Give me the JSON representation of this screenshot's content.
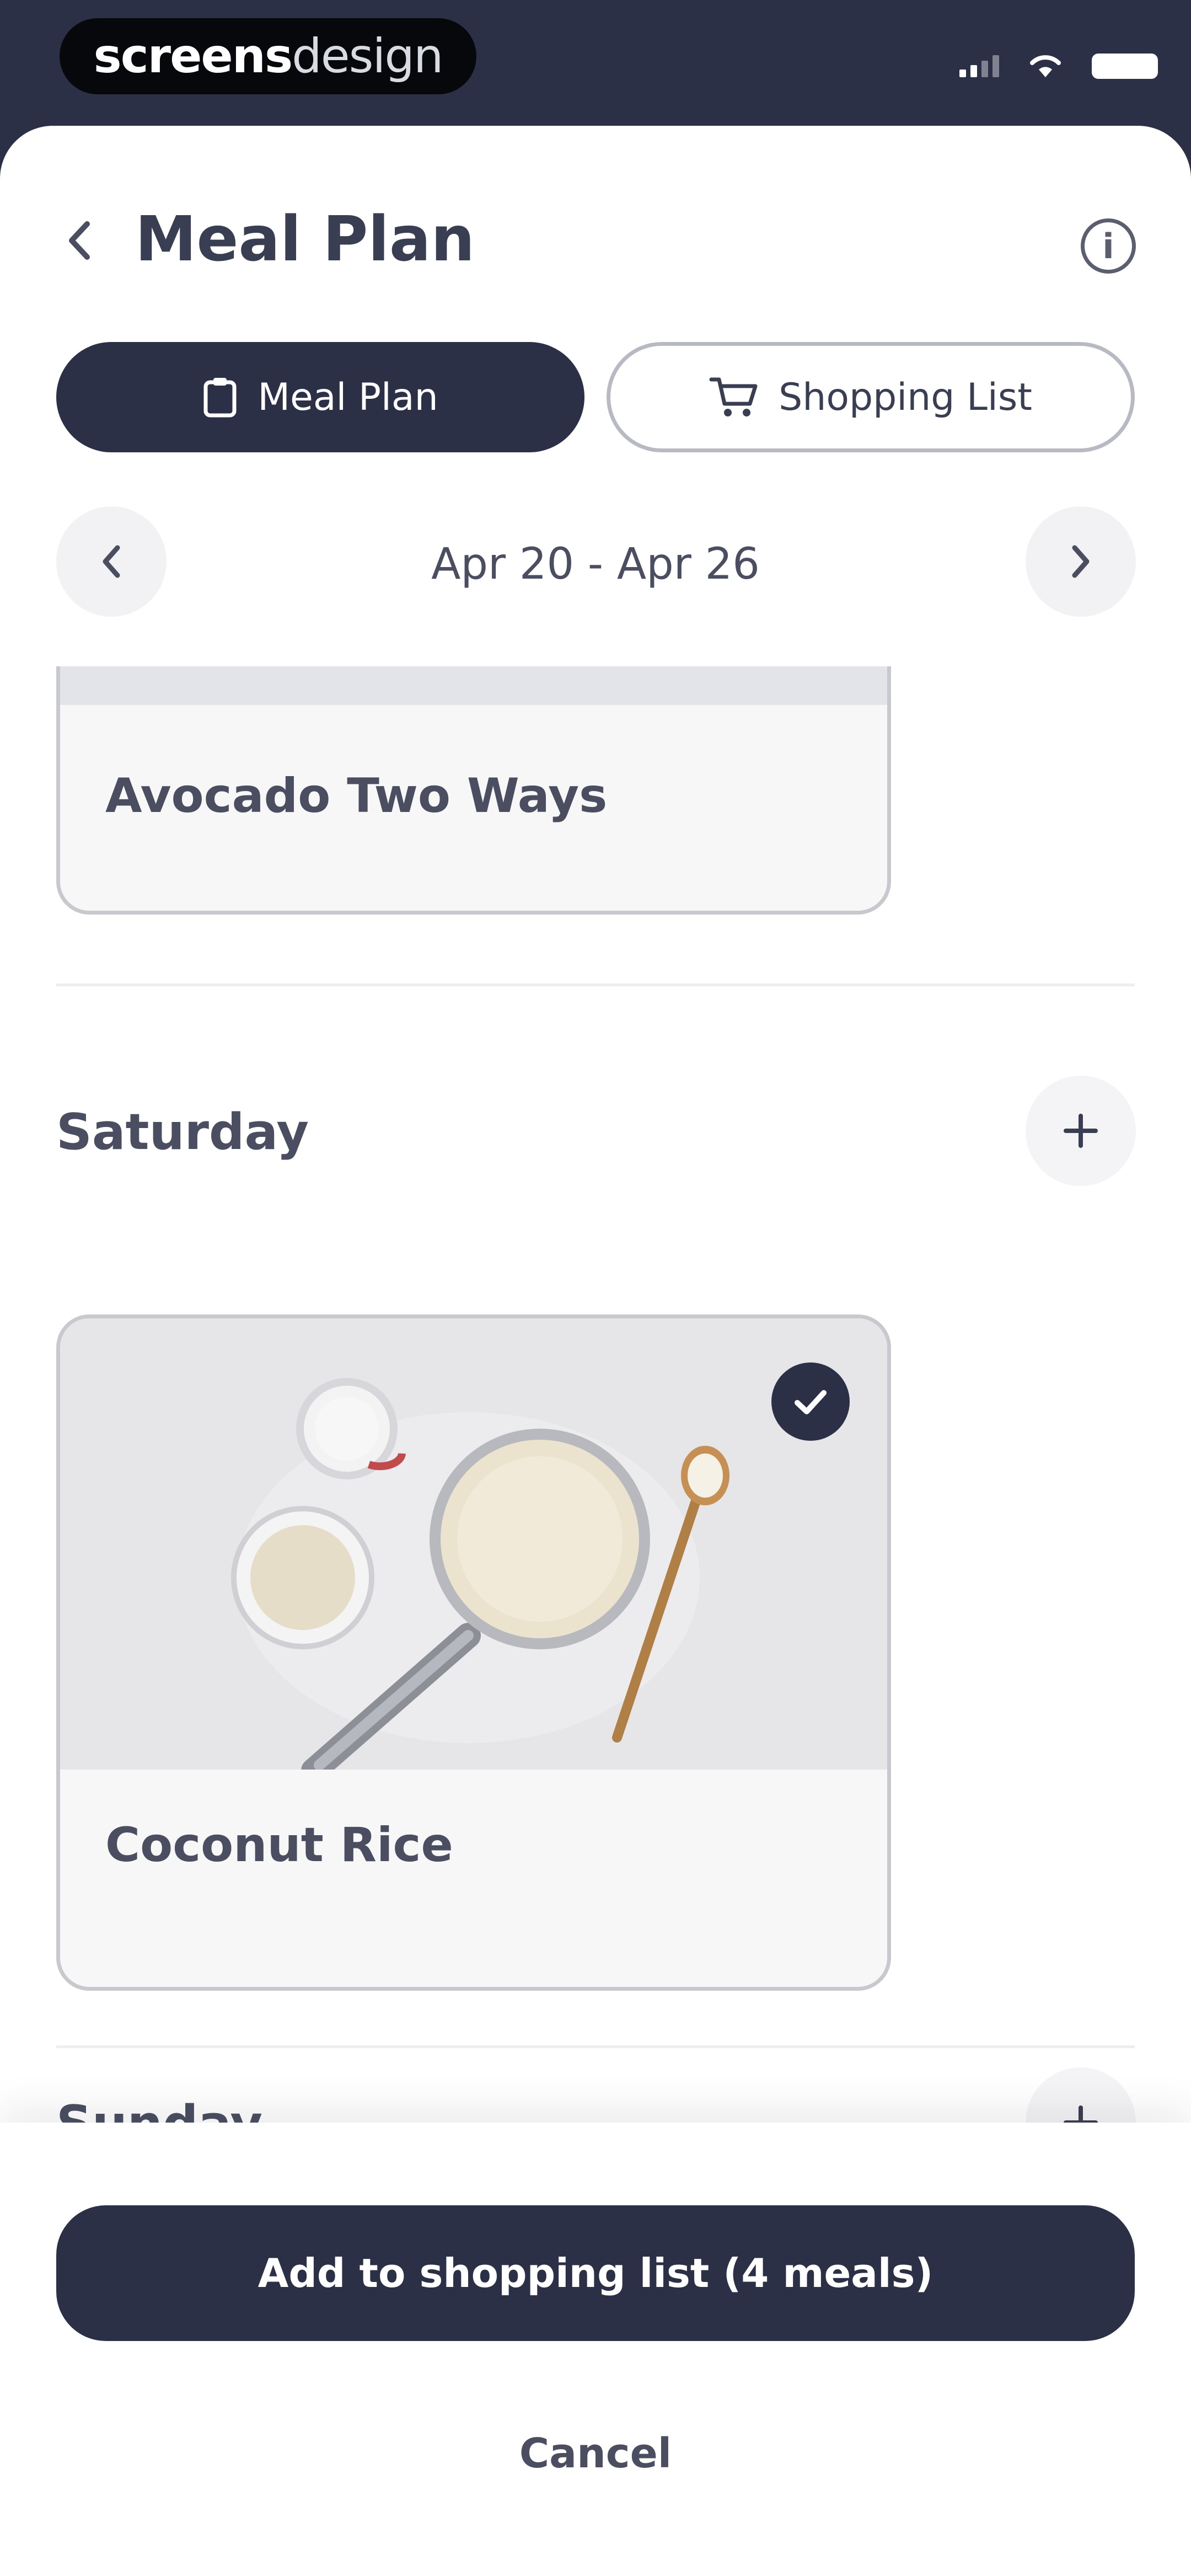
{
  "status_bar": {
    "brand_primary": "screens",
    "brand_secondary": "design",
    "icons": [
      "signal-icon",
      "wifi-icon",
      "battery-icon"
    ]
  },
  "header": {
    "title": "Meal Plan",
    "back_icon": "chevron-left-icon",
    "info_icon": "info-icon"
  },
  "tabs": [
    {
      "label": "Meal Plan",
      "icon": "calendar-icon",
      "active": true
    },
    {
      "label": "Shopping List",
      "icon": "cart-icon",
      "active": false
    }
  ],
  "week": {
    "label": "Apr 20 - Apr 26",
    "prev_icon": "chevron-left-icon",
    "next_icon": "chevron-right-icon"
  },
  "meals": {
    "partial_card": {
      "title": "Avocado Two Ways"
    },
    "saturday_card": {
      "title": "Coconut Rice",
      "selected": true
    }
  },
  "days": [
    {
      "label": "Saturday",
      "add_icon": "plus-icon"
    },
    {
      "label": "Sunday",
      "add_icon": "plus-icon"
    }
  ],
  "footer": {
    "primary_label": "Add to shopping list (4 meals)",
    "cancel_label": "Cancel"
  },
  "colors": {
    "navy": "#2c3046",
    "sheet": "#ffffff",
    "card_bg": "#f7f7f8",
    "card_border": "#c8c9cf"
  }
}
